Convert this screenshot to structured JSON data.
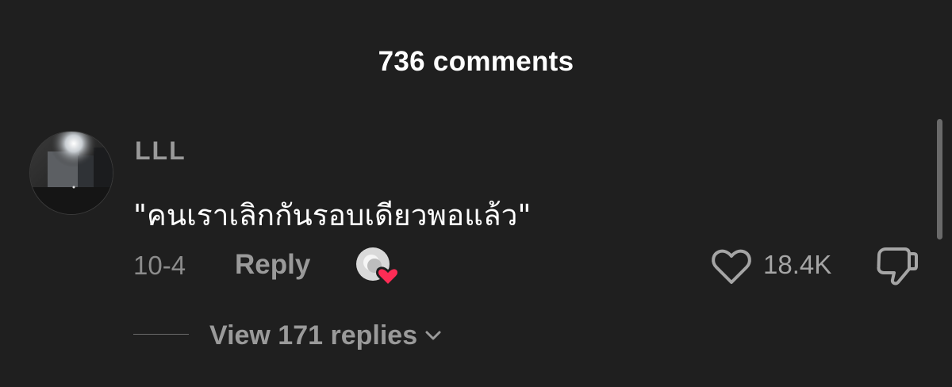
{
  "header": {
    "title": "736 comments"
  },
  "comment": {
    "username": "LLL",
    "text": "\"คนเราเลิกกันรอบเดียวพอแล้ว\"",
    "date": "10-4",
    "reply_label": "Reply",
    "like_count": "18.4K",
    "creator_liked": true,
    "avatar_icon": "profile-photo"
  },
  "replies": {
    "view_label": "View 171 replies"
  },
  "colors": {
    "background": "#1f1f1f",
    "primary_text": "#ffffff",
    "secondary_text": "#9a9a9a",
    "heart_accent": "#fe2c55"
  }
}
